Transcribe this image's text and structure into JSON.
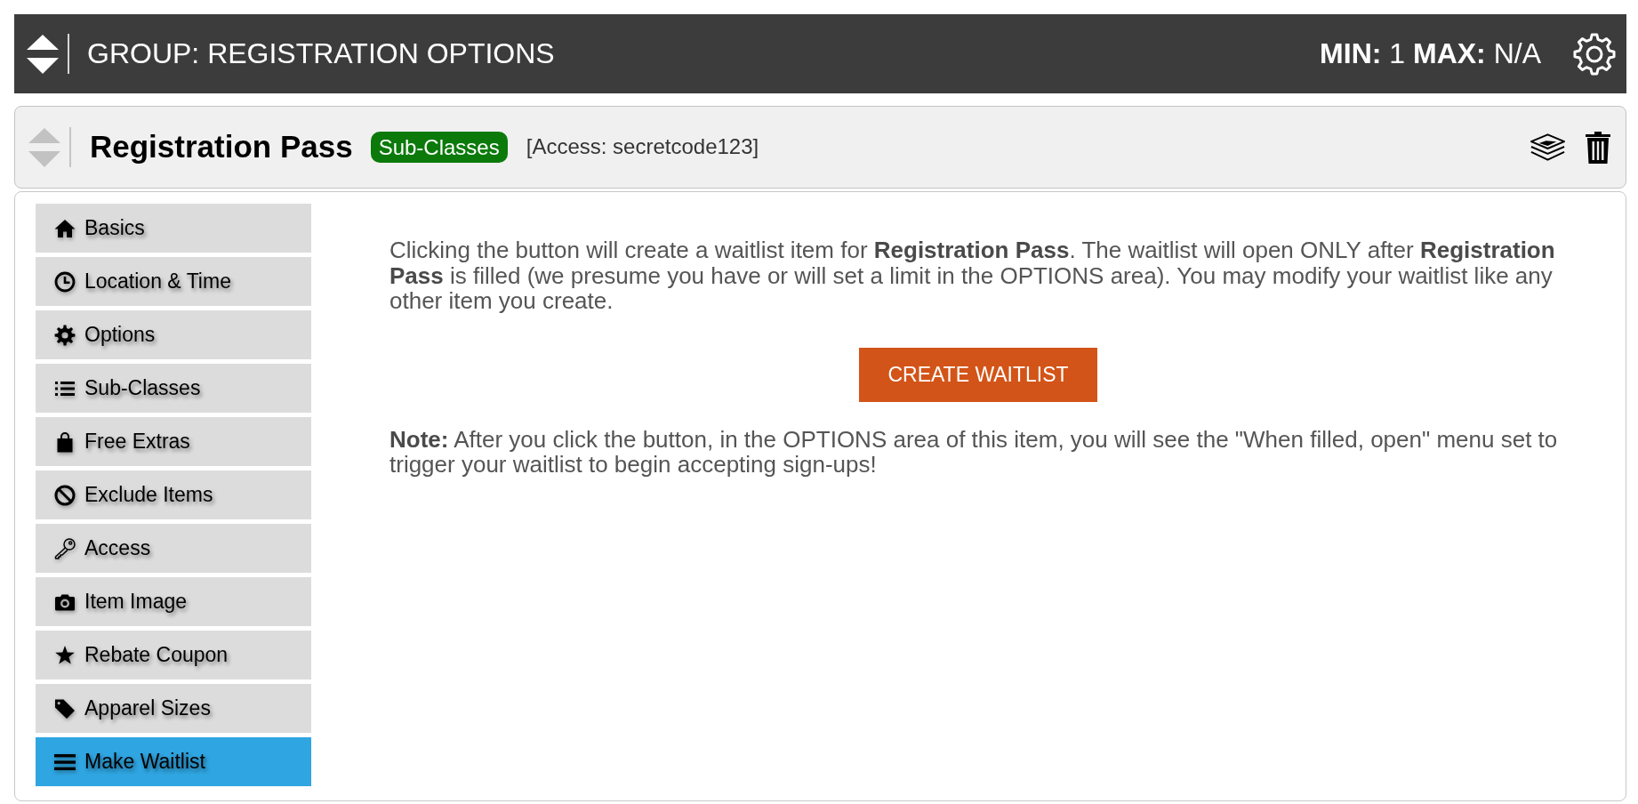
{
  "group": {
    "title": "GROUP: REGISTRATION OPTIONS",
    "limits": "**MIN:** 1 **MAX:** N/A"
  },
  "item": {
    "title": "Registration Pass",
    "badge": "Sub-Classes",
    "access": "[Access: secretcode123]"
  },
  "sidebar": {
    "items": [
      {
        "label": "Basics",
        "selected": false
      },
      {
        "label": "Location & Time",
        "selected": false
      },
      {
        "label": "Options",
        "selected": false
      },
      {
        "label": "Sub-Classes",
        "selected": false
      },
      {
        "label": "Free Extras",
        "selected": false
      },
      {
        "label": "Exclude Items",
        "selected": false
      },
      {
        "label": "Access",
        "selected": false
      },
      {
        "label": "Item Image",
        "selected": false
      },
      {
        "label": "Rebate Coupon",
        "selected": false
      },
      {
        "label": "Apparel Sizes",
        "selected": false
      },
      {
        "label": "Make Waitlist",
        "selected": true
      }
    ]
  },
  "content": {
    "description": "Clicking the button will create a waitlist item for **Registration Pass**. The waitlist will open ONLY after **Registration Pass** is filled (we presume you have or will set a limit in the OPTIONS area). You may modify your waitlist like any other item you create.",
    "button": "CREATE WAITLIST",
    "note": "**Note:** After you click the button, in the OPTIONS area of this item, you will see the \"When filled, open\" menu set to trigger your waitlist to begin accepting sign-ups!"
  }
}
